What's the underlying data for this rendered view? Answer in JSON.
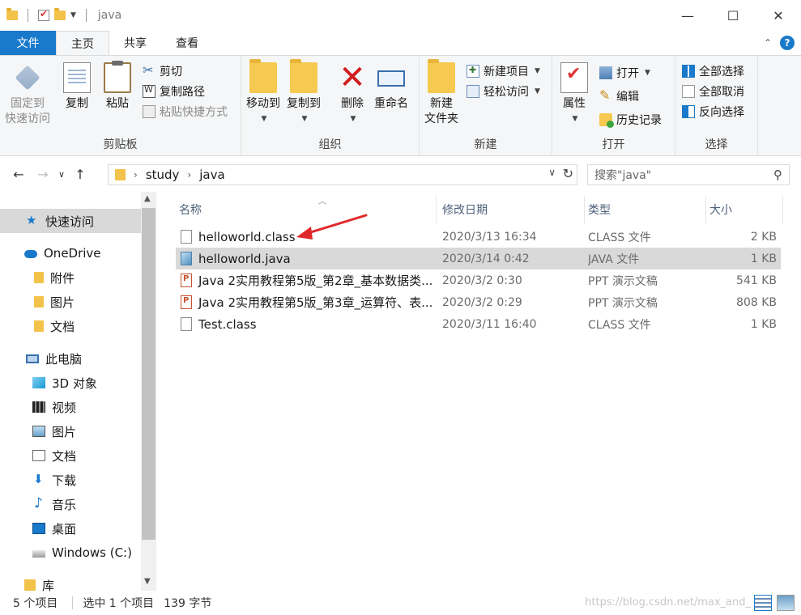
{
  "window": {
    "title": "java",
    "controls": {
      "minimize": "—",
      "maximize": "☐",
      "close": "✕"
    }
  },
  "ribbon_tabs": [
    {
      "label": "文件"
    },
    {
      "label": "主页"
    },
    {
      "label": "共享"
    },
    {
      "label": "查看"
    }
  ],
  "ribbon": {
    "clipboard": {
      "label": "剪贴板",
      "pin": "固定到\n快速访问",
      "copy": "复制",
      "paste": "粘贴",
      "cut": "剪切",
      "copy_path": "复制路径",
      "paste_shortcut": "粘贴快捷方式"
    },
    "organize": {
      "label": "组织",
      "move_to": "移动到",
      "copy_to": "复制到",
      "delete": "删除",
      "rename": "重命名"
    },
    "new": {
      "label": "新建",
      "new_folder": "新建\n文件夹",
      "new_item": "新建项目",
      "easy_access": "轻松访问"
    },
    "open": {
      "label": "打开",
      "properties": "属性",
      "open": "打开",
      "edit": "编辑",
      "history": "历史记录"
    },
    "select": {
      "label": "选择",
      "select_all": "全部选择",
      "select_none": "全部取消",
      "invert": "反向选择"
    }
  },
  "address": {
    "crumbs": [
      "study",
      "java"
    ],
    "search_placeholder": "搜索\"java\""
  },
  "sidebar": {
    "items": [
      {
        "label": "快速访问",
        "icon": "star-icon",
        "selected": true
      },
      {
        "label": "OneDrive",
        "icon": "cloud-icon"
      },
      {
        "label": "附件",
        "icon": "folder-icon"
      },
      {
        "label": "图片",
        "icon": "folder-icon"
      },
      {
        "label": "文档",
        "icon": "folder-icon"
      },
      {
        "label": "此电脑",
        "icon": "computer-icon"
      },
      {
        "label": "3D 对象",
        "icon": "cube-icon"
      },
      {
        "label": "视频",
        "icon": "film-icon"
      },
      {
        "label": "图片",
        "icon": "picture-icon"
      },
      {
        "label": "文档",
        "icon": "document-icon"
      },
      {
        "label": "下载",
        "icon": "download-icon"
      },
      {
        "label": "音乐",
        "icon": "music-icon"
      },
      {
        "label": "桌面",
        "icon": "desktop-icon"
      },
      {
        "label": "Windows (C:)",
        "icon": "drive-icon"
      },
      {
        "label": "库",
        "icon": "library-icon"
      }
    ]
  },
  "columns": {
    "name": "名称",
    "date": "修改日期",
    "type": "类型",
    "size": "大小"
  },
  "files": [
    {
      "name": "helloworld.class",
      "date": "2020/3/13 16:34",
      "type": "CLASS 文件",
      "size": "2 KB",
      "icon": "blank-file-icon"
    },
    {
      "name": "helloworld.java",
      "date": "2020/3/14 0:42",
      "type": "JAVA 文件",
      "size": "1 KB",
      "icon": "java-file-icon",
      "selected": true
    },
    {
      "name": "Java 2实用教程第5版_第2章_基本数据类...",
      "date": "2020/3/2 0:30",
      "type": "PPT 演示文稿",
      "size": "541 KB",
      "icon": "ppt-file-icon"
    },
    {
      "name": "Java 2实用教程第5版_第3章_运算符、表...",
      "date": "2020/3/2 0:29",
      "type": "PPT 演示文稿",
      "size": "808 KB",
      "icon": "ppt-file-icon"
    },
    {
      "name": "Test.class",
      "date": "2020/3/11 16:40",
      "type": "CLASS 文件",
      "size": "1 KB",
      "icon": "blank-file-icon"
    }
  ],
  "status": {
    "count": "5 个项目",
    "selection": "选中 1 个项目",
    "size": "139 字节",
    "watermark": "https://blog.csdn.net/max_and_"
  },
  "colors": {
    "accent": "#1979ca",
    "selection": "#d9d9d9",
    "annotation_arrow": "#e0282a"
  }
}
